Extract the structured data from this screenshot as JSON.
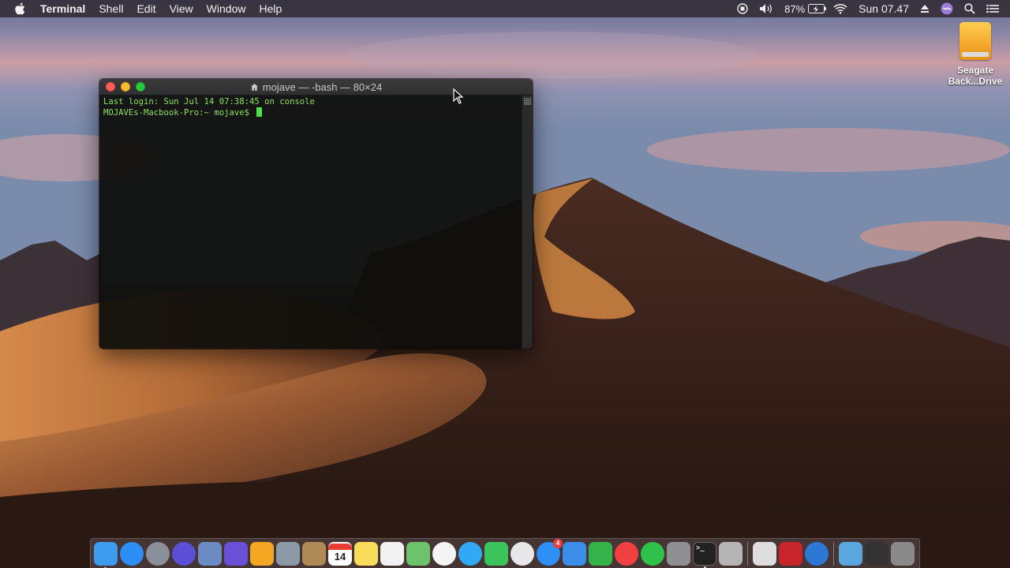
{
  "menubar": {
    "apple_icon": "apple-logo",
    "app_name": "Terminal",
    "menus": [
      "Shell",
      "Edit",
      "View",
      "Window",
      "Help"
    ],
    "status": {
      "battery_percent": "87%",
      "clock": "Sun 07.47",
      "icons": [
        "screen-record-icon",
        "volume-icon",
        "battery-icon",
        "wifi-icon",
        "eject-icon",
        "siri-icon",
        "spotlight-icon",
        "notification-center-icon"
      ]
    }
  },
  "desktop": {
    "drive_label_line1": "Seagate",
    "drive_label_line2": "Back...Drive"
  },
  "terminal": {
    "title": "mojave — -bash — 80×24",
    "lines": [
      "Last login: Sun Jul 14 07:38:45 on console",
      "MOJAVEs-Macbook-Pro:~ mojave$ "
    ],
    "colors": {
      "text": "#8ee05a",
      "cursor": "#4ce04a",
      "background": "#0e0e0c"
    }
  },
  "dock": {
    "calendar_day": "14",
    "app_store_badge": "4",
    "items": [
      {
        "name": "finder",
        "color": "#3d9cf0"
      },
      {
        "name": "safari",
        "color": "#2d8ef5"
      },
      {
        "name": "launchpad",
        "color": "#8b8f99"
      },
      {
        "name": "siri",
        "color": "#5a4fd6"
      },
      {
        "name": "preview",
        "color": "#6b8bc2"
      },
      {
        "name": "imovie",
        "color": "#6a4fd8"
      },
      {
        "name": "pages",
        "color": "#f5a623"
      },
      {
        "name": "image-capture",
        "color": "#8c9aa8"
      },
      {
        "name": "contacts",
        "color": "#b08a54"
      },
      {
        "name": "calendar",
        "color": "#ffffff"
      },
      {
        "name": "notes",
        "color": "#f7dd5a"
      },
      {
        "name": "reminders",
        "color": "#f2f2f2"
      },
      {
        "name": "maps",
        "color": "#6cc36a"
      },
      {
        "name": "photos",
        "color": "#f4f4f4"
      },
      {
        "name": "messages",
        "color": "#31a9f5"
      },
      {
        "name": "facetime",
        "color": "#3ac45a"
      },
      {
        "name": "itunes",
        "color": "#e7e7ea"
      },
      {
        "name": "app-store",
        "color": "#2e8ff5"
      },
      {
        "name": "keynote",
        "color": "#3b8eea"
      },
      {
        "name": "numbers",
        "color": "#33b34a"
      },
      {
        "name": "news",
        "color": "#f0403f"
      },
      {
        "name": "whatsapp",
        "color": "#2fc24b"
      },
      {
        "name": "system-preferences",
        "color": "#8e8e93"
      },
      {
        "name": "terminal",
        "color": "#222222"
      },
      {
        "name": "installer",
        "color": "#b5b5b5"
      }
    ],
    "extras": [
      {
        "name": "script-editor",
        "color": "#dddddd"
      },
      {
        "name": "photo-booth",
        "color": "#c8242b"
      },
      {
        "name": "edge",
        "color": "#2d78d4"
      }
    ],
    "stacks": [
      {
        "name": "downloads-folder",
        "color": "#5aa7e0"
      },
      {
        "name": "terminal-stack",
        "color": "#333333"
      },
      {
        "name": "trash",
        "color": "#8a8a8a"
      }
    ]
  }
}
